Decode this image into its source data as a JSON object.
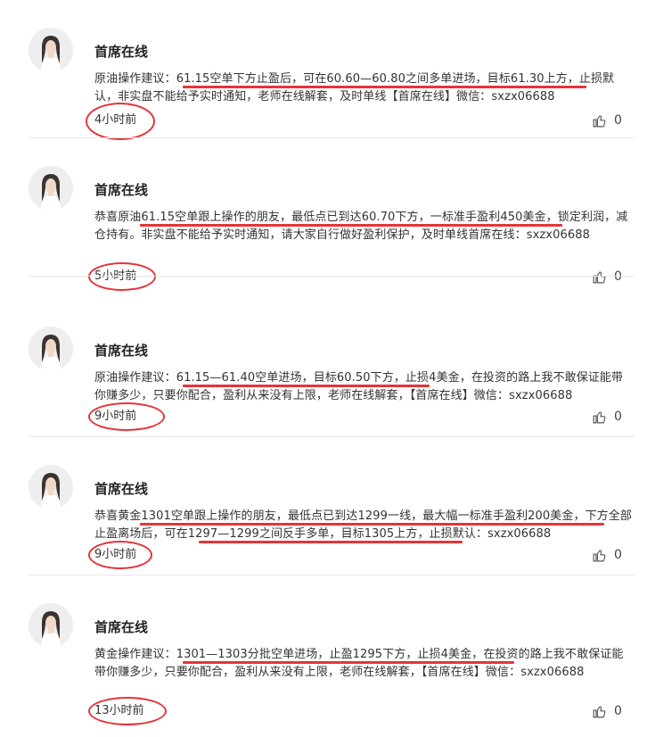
{
  "posts": [
    {
      "author": "首席在线",
      "text": "原油操作建议：61.15空单下方止盈后，可在60.60—60.80之间多单进场，目标61.30上方，止损默认，非实盘不能给予实时通知，老师在线解套，及时单线【首席在线】微信：sxzx06688",
      "time": "4小时前",
      "likes": "0"
    },
    {
      "author": "首席在线",
      "text": "恭喜原油61.15空单跟上操作的朋友，最低点已到达60.70下方，一标准手盈利450美金，锁定利润，减仓持有。非实盘不能给予实时通知，请大家自行做好盈利保护，及时单线首席在线：sxzx06688",
      "time": "5小时前",
      "likes": "0"
    },
    {
      "author": "首席在线",
      "text": "原油操作建议：61.15—61.40空单进场，目标60.50下方，止损4美金，在投资的路上我不敢保证能带你赚多少，只要你配合，盈利从来没有上限，老师在线解套，【首席在线】微信：sxzx06688",
      "time": "9小时前",
      "likes": "0"
    },
    {
      "author": "首席在线",
      "text": "恭喜黄金1301空单跟上操作的朋友，最低点已到达1299一线，最大幅一标准手盈利200美金，下方全部止盈离场后，可在1297—1299之间反手多单，目标1305上方，止损默认：sxzx06688",
      "time": "9小时前",
      "likes": "0"
    },
    {
      "author": "首席在线",
      "text": "黄金操作建议：1301—1303分批空单进场，止盈1295下方，止损4美金，在投资的路上我不敢保证能带你赚多少，只要你配合，盈利从来没有上限，老师在线解套，【首席在线】微信：sxzx06688",
      "time": "13小时前",
      "likes": "0"
    }
  ],
  "colors": {
    "annotation_red": "#e5343a",
    "divider": "#e8e8e8",
    "text": "#333333"
  },
  "icons": {
    "like": "thumbs-up-icon",
    "avatar": "avatar-portrait"
  }
}
